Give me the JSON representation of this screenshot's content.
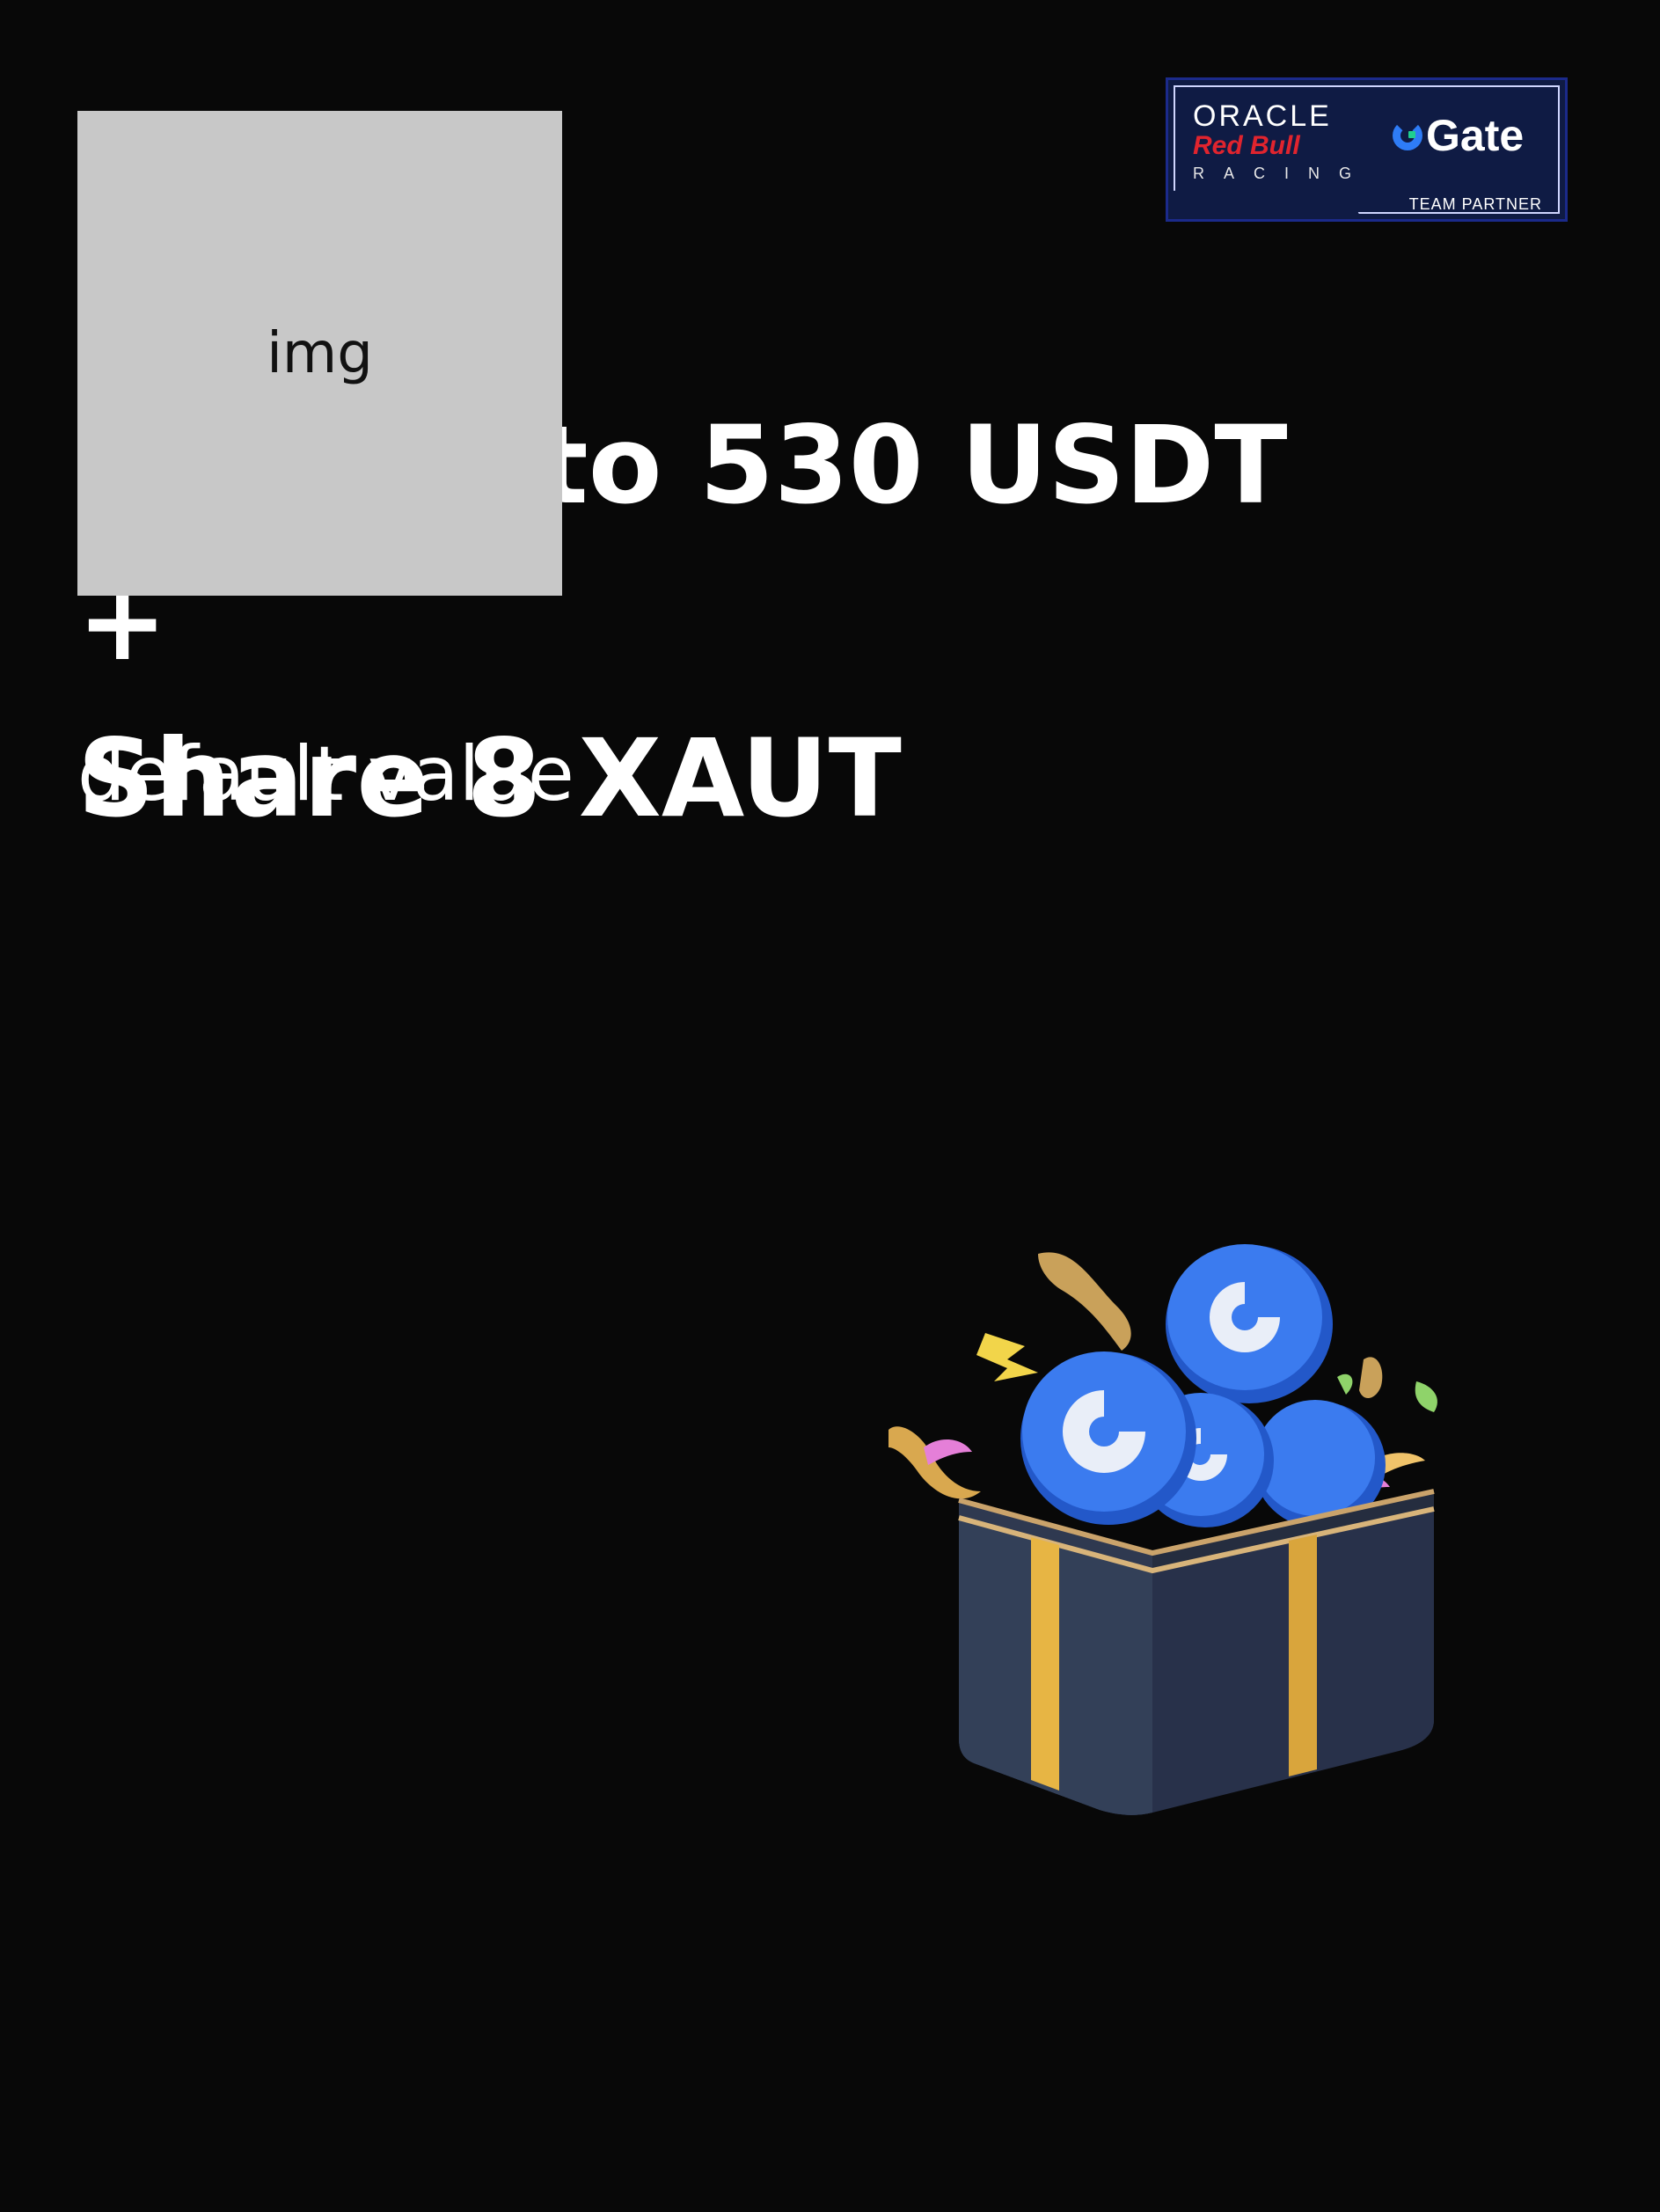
{
  "image_placeholder": {
    "label": "img"
  },
  "badge": {
    "oracle": "ORACLE",
    "redbull": "Red Bull",
    "racing": "RACING",
    "gate": "Gate",
    "partner": "TEAM PARTNER"
  },
  "headline": {
    "title": "Win up to 530 USDT +\nShare 8 XAUT",
    "subtitle": "default value"
  },
  "illustration": {
    "name": "gift-box-with-gate-coins",
    "colors": {
      "coin": "#2f6ee0",
      "box": "#2b3448",
      "ribbon": "#e7b544"
    }
  }
}
